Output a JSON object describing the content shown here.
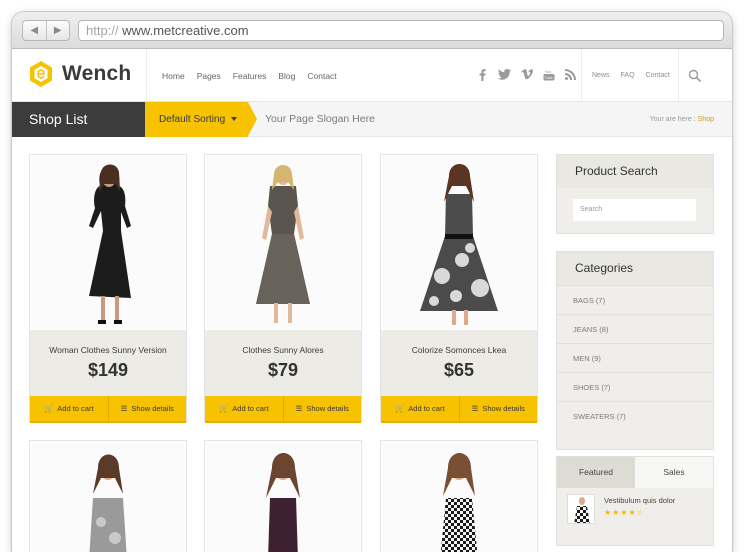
{
  "browser": {
    "url_protocol": "http://",
    "url_host": "www.metcreative.com"
  },
  "header": {
    "brand": "Wench",
    "nav": [
      "Home",
      "Pages",
      "Features",
      "Blog",
      "Contact"
    ],
    "social_icons": [
      "facebook-icon",
      "twitter-icon",
      "vimeo-icon",
      "youtube-icon",
      "rss-icon"
    ],
    "top_links": [
      "News",
      "FAQ",
      "Contact"
    ]
  },
  "titlebar": {
    "title": "Shop List",
    "sorting": "Default Sorting",
    "slogan": "Your Page Slogan Here",
    "crumb_prefix": "Your are here :",
    "crumb_current": "Shop"
  },
  "products": [
    {
      "name": "Woman Clothes Sunny Version",
      "price": "$149",
      "add_label": "Add to cart",
      "details_label": "Show details"
    },
    {
      "name": "Clothes Sunny Alores",
      "price": "$79",
      "add_label": "Add to cart",
      "details_label": "Show details"
    },
    {
      "name": "Colorize Somonces Lkea",
      "price": "$65",
      "add_label": "Add to cart",
      "details_label": "Show details"
    }
  ],
  "sidebar": {
    "search_title": "Product Search",
    "search_placeholder": "Search",
    "categories_title": "Categories",
    "categories": [
      "BAGS (7)",
      "JEANS (8)",
      "MEN (9)",
      "SHOES (7)",
      "SWEATERS (7)"
    ],
    "tabs": [
      "Featured",
      "Sales"
    ],
    "featured_item_title": "Vestibulum quis dolor",
    "featured_item_stars": "★★★★☆"
  },
  "colors": {
    "accent": "#f7c200",
    "dark": "#3c3c3c"
  }
}
